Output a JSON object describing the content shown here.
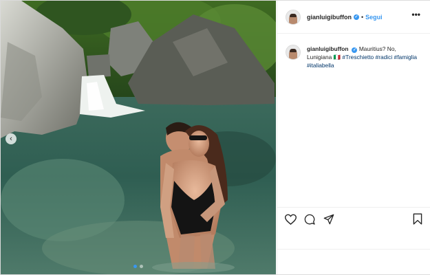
{
  "post": {
    "username": "gianluigibuffon",
    "separator": "•",
    "follow_label": "Segui",
    "more_icon": "more-horizontal-icon",
    "verified_icon": "verified-badge-icon"
  },
  "caption": {
    "username": "gianluigibuffon",
    "text_plain": "Mauritius? No, Lunigiana 🇮🇹 ",
    "hashtags": [
      "#Treschietto",
      "#radici",
      "#famiglia",
      "#italiabella"
    ]
  },
  "actions": {
    "like_icon": "heart-icon",
    "comment_icon": "comment-icon",
    "share_icon": "paper-plane-icon",
    "save_icon": "bookmark-icon"
  },
  "carousel": {
    "prev_icon": "chevron-left-icon",
    "slides": 2,
    "active_index": 1
  },
  "colors": {
    "accent": "#3897f0",
    "hashtag": "#003569",
    "text": "#262626",
    "border": "#dbdbdb"
  }
}
